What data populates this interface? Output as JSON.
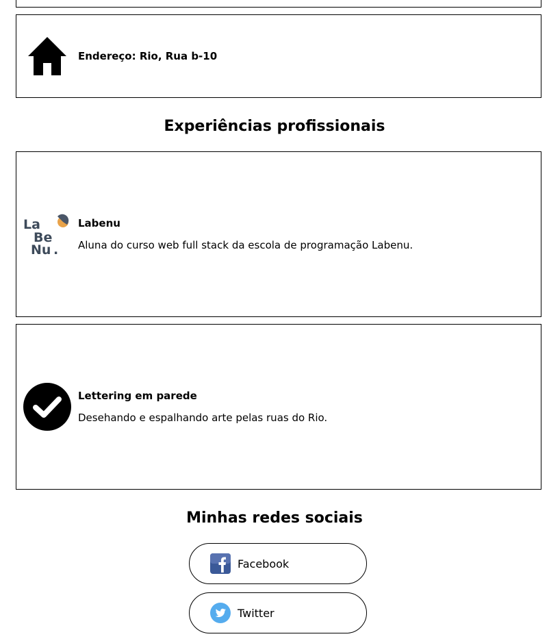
{
  "address": {
    "icon": "home-icon",
    "text": "Endereço: Rio, Rua b-10"
  },
  "experience_section": {
    "title": "Experiências profissionais",
    "items": [
      {
        "icon": "labenu-logo",
        "title": "Labenu",
        "description": "Aluna do curso web full stack da escola de programação Labenu."
      },
      {
        "icon": "check-circle-icon",
        "title": "Lettering em parede",
        "description": "Desehando e espalhando arte pelas ruas do Rio."
      }
    ]
  },
  "social_section": {
    "title": "Minhas redes sociais",
    "links": [
      {
        "icon": "facebook-icon",
        "label": "Facebook",
        "color": "#3b5998"
      },
      {
        "icon": "twitter-icon",
        "label": "Twitter",
        "color": "#55acee"
      }
    ]
  },
  "logo": {
    "lines": [
      "La",
      "Be",
      "Nu"
    ],
    "dot": "."
  }
}
